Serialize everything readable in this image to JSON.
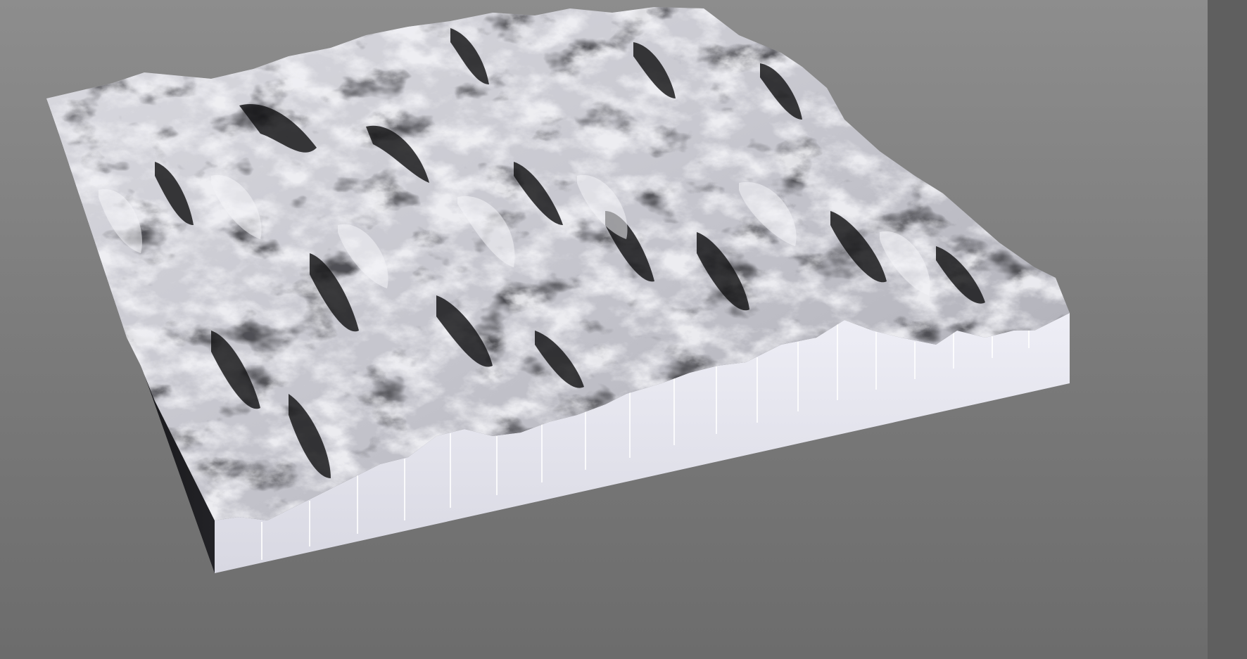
{
  "scene": {
    "subject": "terrain-relief-model",
    "colors": {
      "background_top": "#8d8d8d",
      "background_bottom": "#6c6c6c",
      "right_strip": "#5f5f5f",
      "terrain_light": "#e9e9ee",
      "terrain_mid": "#a9a9b0",
      "terrain_dark": "#1a1a1c",
      "front_face": "#e6e6f0",
      "side_face": "#141416",
      "panel_seam": "#ffffff"
    }
  }
}
